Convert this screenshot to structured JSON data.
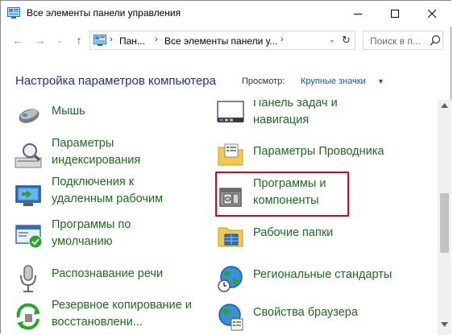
{
  "window": {
    "title": "Все элементы панели управления",
    "icon": "control-panel-icon",
    "minimize_glyph": "—",
    "maximize_glyph": "☐",
    "close_glyph": "✕"
  },
  "nav": {
    "back_glyph": "←",
    "forward_glyph": "→",
    "history_glyph": "⌄",
    "up_glyph": "↑"
  },
  "address": {
    "sep1": "›",
    "crumb1": "Пан...",
    "sep2": "›",
    "crumb2": "Все элементы панели у...",
    "sep3": "›",
    "dropdown_glyph": "⌄",
    "refresh_glyph": "↻"
  },
  "search": {
    "placeholder": "Поиск в п..."
  },
  "header": {
    "title": "Настройка параметров компьютера",
    "view_label": "Просмотр:",
    "view_value": "Крупные значки",
    "view_caret": "▼"
  },
  "items_left": [
    {
      "label": "Мышь",
      "icon": "mouse-icon"
    },
    {
      "label": "Параметры\nиндексирования",
      "icon": "indexing-icon"
    },
    {
      "label": "Подключения к\nудаленным рабочим",
      "icon": "remote-desktop-icon"
    },
    {
      "label": "Программы по\nумолчанию",
      "icon": "default-programs-icon"
    },
    {
      "label": "Распознавание речи",
      "icon": "microphone-icon"
    },
    {
      "label": "Резервное копирование и\nвосстановлени...",
      "icon": "backup-icon"
    }
  ],
  "items_right": [
    {
      "label": "Панель задач и\nнавигация",
      "icon": "taskbar-icon"
    },
    {
      "label": "Параметры Проводника",
      "icon": "folder-options-icon"
    },
    {
      "label": "Программы и\nкомпоненты",
      "icon": "programs-features-icon"
    },
    {
      "label": "Рабочие папки",
      "icon": "work-folders-icon"
    },
    {
      "label": "Региональные стандарты",
      "icon": "region-icon"
    },
    {
      "label": "Свойства браузера",
      "icon": "internet-options-icon"
    }
  ],
  "colors": {
    "link": "#1e6b1e",
    "heading": "#1e3287",
    "highlight": "#e0001a"
  }
}
